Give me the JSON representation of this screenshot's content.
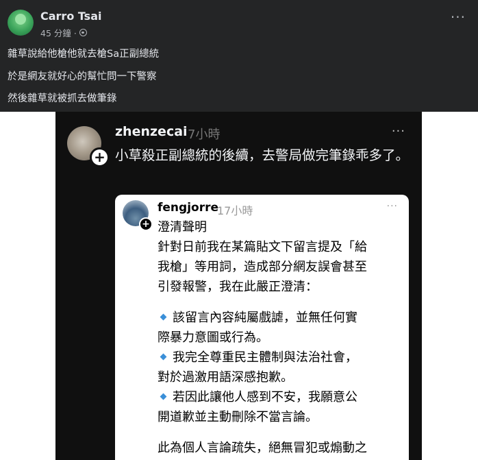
{
  "post": {
    "author": "Carro Tsai",
    "time": "45 分鐘 ·",
    "lines": [
      "雜草說給他槍他就去槍Sa正副總統",
      "於是網友就好心的幫忙問一下警察",
      "然後雜草就被抓去做筆錄"
    ],
    "more": "···"
  },
  "screenshot": {
    "username": "zhenzecai",
    "time": "7小時",
    "more": "···",
    "text": "小草殺正副總統的後續，去警局做完筆錄乖多了。",
    "quoted": {
      "username": "fengjorre",
      "time": "17小時",
      "more": "···",
      "lines": [
        "澄清聲明",
        "針對日前我在某篇貼文下留言提及「給",
        "我槍」等用詞，造成部分網友誤會甚至",
        "引發報警，我在此嚴正澄清：",
        "該留言內容純屬戲謔，並無任何實",
        "際暴力意圖或行為。",
        "我完全尊重民主體制與法治社會，",
        "對於過激用語深感抱歉。",
        "若因此讓他人感到不安，我願意公",
        "開道歉並主動刪除不當言論。",
        "此為個人言論疏失，絕無冒犯或煽動之"
      ]
    }
  }
}
